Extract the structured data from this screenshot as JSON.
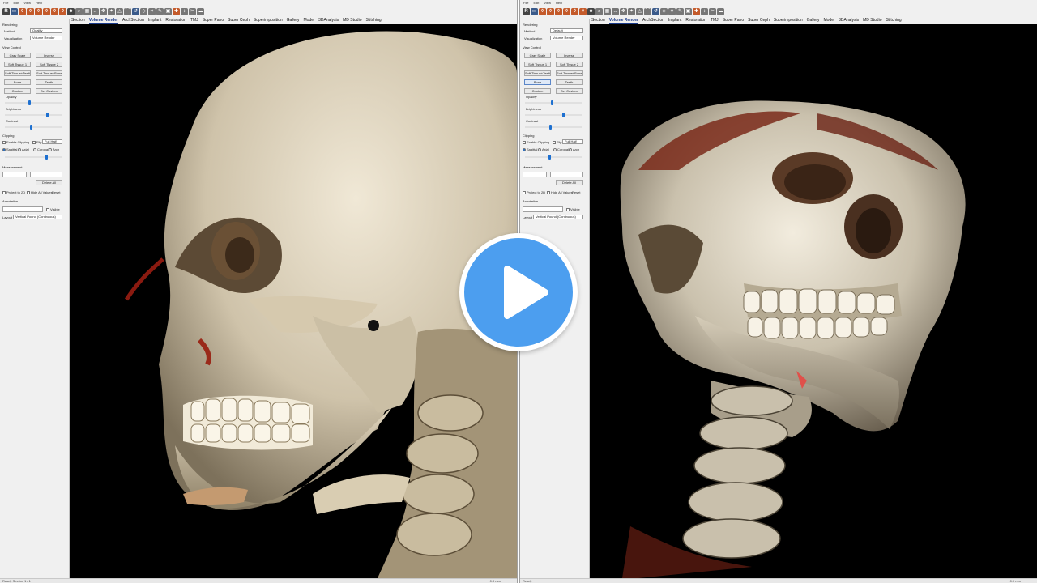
{
  "panes": [
    {
      "id": "left",
      "menu": [
        "File",
        "Edit",
        "View",
        "Help"
      ],
      "tabs": [
        "Section",
        "Volume Render",
        "ArchSection",
        "Implant",
        "Restoration",
        "TMJ",
        "Super Pano",
        "Super Ceph",
        "Superimposition",
        "Gallery",
        "Model",
        "3DAnalysis",
        "MD Studio",
        "Stitching"
      ],
      "active_tab": "Volume Render",
      "rendering": {
        "title": "Rendering",
        "method_label": "Method",
        "method_value": "Quality",
        "visualization_label": "Visualization",
        "visualization_value": "Volume Render"
      },
      "view_control": {
        "title": "View Control",
        "buttons": [
          "Gray Scale",
          "Inverse",
          "Soft Tissue 1",
          "Soft Tissue 2",
          "Soft Tissue+Teeth",
          "Soft Tissue+Bone",
          "Bone",
          "Teeth",
          "Custom",
          "Set Custom"
        ],
        "active_button": "",
        "sliders": [
          {
            "label": "Opacity",
            "value": 0.44
          },
          {
            "label": "Brightness",
            "value": 0.75
          },
          {
            "label": "Contrast",
            "value": 0.46
          }
        ]
      },
      "clipping": {
        "title": "Clipping",
        "enable_label": "Enable Clipping",
        "flip_label": "Flip",
        "mode_value": "Full Half",
        "planes": [
          "Sagittal",
          "Axial",
          "Coronal",
          "Arch"
        ],
        "selected_plane": "Sagittal",
        "position": 0.74
      },
      "measurement": {
        "title": "Measurement",
        "delete_label": "Delete All",
        "project_label": "Project to 2D",
        "hide_label": "Hide All Values",
        "reset_label": "Reset"
      },
      "annotation": {
        "title": "Annotation",
        "visible_label": "Visible"
      },
      "layout": {
        "label": "Layout",
        "value": "Vertical Pound (Continuous)"
      },
      "status_left": "Ready  Section 1 / 1",
      "status_right": "0.0 mm"
    },
    {
      "id": "right",
      "menu": [
        "File",
        "Edit",
        "View",
        "Help"
      ],
      "tabs": [
        "Section",
        "Volume Render",
        "ArchSection",
        "Implant",
        "Restoration",
        "TMJ",
        "Super Pano",
        "Super Ceph",
        "Superimposition",
        "Gallery",
        "Model",
        "3DAnalysis",
        "MD Studio",
        "Stitching"
      ],
      "active_tab": "Volume Render",
      "rendering": {
        "title": "Rendering",
        "method_label": "Method",
        "method_value": "Default",
        "visualization_label": "Visualization",
        "visualization_value": "Volume Render"
      },
      "view_control": {
        "title": "View Control",
        "buttons": [
          "Gray Scale",
          "Inverse",
          "Soft Tissue 1",
          "Soft Tissue 2",
          "Soft Tissue+Teeth",
          "Soft Tissue+Bone",
          "Bone",
          "Teeth",
          "Custom",
          "Set Custom"
        ],
        "active_button": "Bone",
        "sliders": [
          {
            "label": "Opacity",
            "value": 0.48
          },
          {
            "label": "Brightness",
            "value": 0.68
          },
          {
            "label": "Contrast",
            "value": 0.45
          }
        ]
      },
      "clipping": {
        "title": "Clipping",
        "enable_label": "Enable Clipping",
        "flip_label": "Flip",
        "mode_value": "Full Half",
        "planes": [
          "Sagittal",
          "Axial",
          "Coronal",
          "Arch"
        ],
        "selected_plane": "Sagittal",
        "position": 0.43
      },
      "measurement": {
        "title": "Measurement",
        "delete_label": "Delete All",
        "project_label": "Project to 2D",
        "hide_label": "Hide All Values",
        "reset_label": "Reset"
      },
      "annotation": {
        "title": "Annotation",
        "visible_label": "Visible"
      },
      "layout": {
        "label": "Layout",
        "value": "Vertical Pound (Continuous)"
      },
      "status_left": "Ready",
      "status_right": "0.0 mm"
    }
  ],
  "colors": {
    "accent": "#1e70d0",
    "play": "#4c9eef",
    "viewport_bg": "#000000",
    "bone": "#e4dac6",
    "tissue": "#7a2a1a"
  },
  "icons": [
    "play-icon"
  ]
}
